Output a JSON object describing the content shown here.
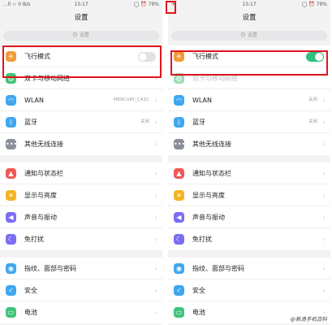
{
  "left": {
    "status": {
      "left": "...ll ☆ 0 B/s",
      "time": "13:17",
      "right": "◯ ⏰ 79%"
    },
    "title": "设置",
    "search_placeholder": "设置",
    "rows": {
      "airplane": "飞行模式",
      "dual_sim": "双卡与移动网络",
      "wlan": "WLAN",
      "wlan_value": "MERCURY_CA1C",
      "bluetooth": "蓝牙",
      "bluetooth_value": "关闭",
      "other_wireless": "其他无线连接",
      "notification": "通知与状态栏",
      "display": "显示与亮度",
      "sound": "声音与振动",
      "dnd": "免打扰",
      "biometrics": "指纹、面部与密码",
      "security": "安全",
      "battery": "电池"
    },
    "airplane_on": false
  },
  "right": {
    "status": {
      "left": "✈",
      "time": "13:17",
      "right": "◯ ⏰ 79%"
    },
    "title": "设置",
    "search_placeholder": "设置",
    "rows": {
      "airplane": "飞行模式",
      "dual_sim": "双卡与移动网络",
      "wlan": "WLAN",
      "wlan_value": "关闭",
      "bluetooth": "蓝牙",
      "bluetooth_value": "关闭",
      "other_wireless": "其他无线连接",
      "notification": "通知与状态栏",
      "display": "显示与亮度",
      "sound": "声音与振动",
      "dnd": "免打扰",
      "biometrics": "指纹、面部与密码",
      "security": "安全",
      "battery": "电池"
    },
    "airplane_on": true
  },
  "watermark": "@新浪手机百科",
  "icons": {
    "airplane": "airplane-icon",
    "dual_sim": "globe-icon",
    "wlan": "wifi-icon",
    "bluetooth": "bluetooth-icon",
    "other_wireless": "more-icon",
    "notification": "bell-icon",
    "display": "sun-icon",
    "sound": "speaker-icon",
    "dnd": "moon-icon",
    "biometrics": "fingerprint-icon",
    "security": "shield-icon",
    "battery": "battery-icon"
  },
  "colors": {
    "airplane": "#f29a3a",
    "dual_sim": "#42c27a",
    "wlan": "#3fa7f0",
    "bluetooth": "#3fa7f0",
    "other_wireless": "#8a8f99",
    "notification": "#ef5a55",
    "display": "#f5b322",
    "sound": "#7b6df2",
    "dnd": "#7b6df2",
    "biometrics": "#3fa7f0",
    "security": "#3fa7f0",
    "battery": "#42c27a",
    "toggle_on": "#2ec280",
    "highlight": "#e1141b"
  }
}
